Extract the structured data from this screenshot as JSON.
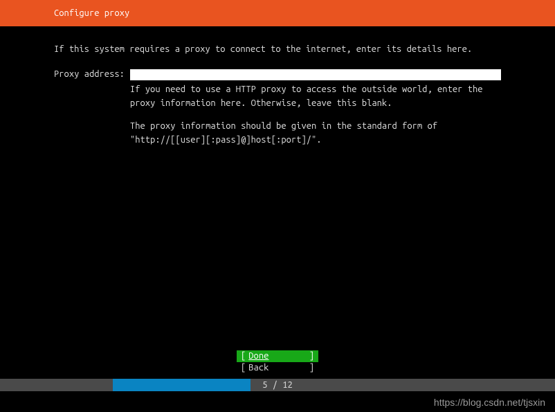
{
  "header": {
    "title": "Configure proxy"
  },
  "content": {
    "instruction": "If this system requires a proxy to connect to the internet, enter its details here.",
    "proxy_label": "Proxy address:",
    "proxy_value": "",
    "help1": "If you need to use a HTTP proxy to access the outside world, enter the proxy information here. Otherwise, leave this blank.",
    "help2": "The proxy information should be given in the standard form of \"http://[[user][:pass]@]host[:port]/\"."
  },
  "buttons": {
    "done": "Done",
    "back": "Back"
  },
  "progress": {
    "current": 5,
    "total": 12,
    "text": "5 / 12"
  },
  "watermark": "https://blog.csdn.net/tjsxin"
}
